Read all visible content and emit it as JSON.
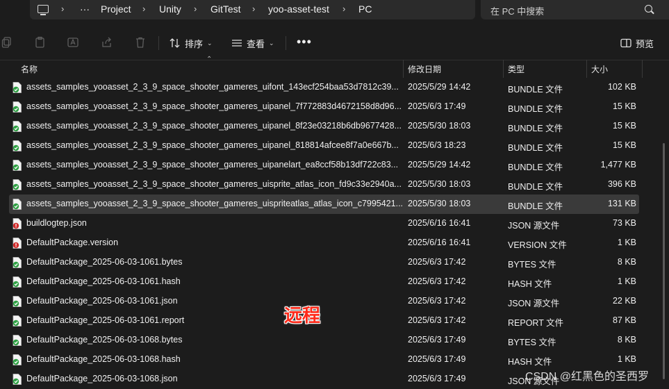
{
  "address_bar": {
    "breadcrumbs": [
      "Project",
      "Unity",
      "GitTest",
      "yoo-asset-test",
      "PC"
    ],
    "overflow": "···"
  },
  "search": {
    "placeholder": "在 PC 中搜索"
  },
  "toolbar": {
    "sort_label": "排序",
    "view_label": "查看",
    "preview_label": "预览"
  },
  "columns": {
    "name": "名称",
    "modified": "修改日期",
    "type": "类型",
    "size": "大小"
  },
  "files": [
    {
      "name": "assets_samples_yooasset_2_3_9_space_shooter_gameres_uifont_143ecf254baa53d7812c39...",
      "date": "2025/5/29 14:42",
      "type": "BUNDLE 文件",
      "size": "102 KB",
      "icon": "green-file-icon"
    },
    {
      "name": "assets_samples_yooasset_2_3_9_space_shooter_gameres_uipanel_7f772883d4672158d8d96...",
      "date": "2025/6/3 17:49",
      "type": "BUNDLE 文件",
      "size": "15 KB",
      "icon": "green-file-icon"
    },
    {
      "name": "assets_samples_yooasset_2_3_9_space_shooter_gameres_uipanel_8f23e03218b6db9677428...",
      "date": "2025/5/30 18:03",
      "type": "BUNDLE 文件",
      "size": "15 KB",
      "icon": "green-file-icon"
    },
    {
      "name": "assets_samples_yooasset_2_3_9_space_shooter_gameres_uipanel_818814afcee8f7a0e667b...",
      "date": "2025/6/3 18:23",
      "type": "BUNDLE 文件",
      "size": "15 KB",
      "icon": "green-file-icon"
    },
    {
      "name": "assets_samples_yooasset_2_3_9_space_shooter_gameres_uipanelart_ea8ccf58b13df722c83...",
      "date": "2025/5/29 14:42",
      "type": "BUNDLE 文件",
      "size": "1,477 KB",
      "icon": "green-file-icon"
    },
    {
      "name": "assets_samples_yooasset_2_3_9_space_shooter_gameres_uisprite_atlas_icon_fd9c33e2940a...",
      "date": "2025/5/30 18:03",
      "type": "BUNDLE 文件",
      "size": "396 KB",
      "icon": "green-file-icon"
    },
    {
      "name": "assets_samples_yooasset_2_3_9_space_shooter_gameres_uispriteatlas_atlas_icon_c7995421...",
      "date": "2025/5/30 18:03",
      "type": "BUNDLE 文件",
      "size": "131 KB",
      "icon": "green-file-icon",
      "selected": true
    },
    {
      "name": "buildlogtep.json",
      "date": "2025/6/16 16:41",
      "type": "JSON 源文件",
      "size": "73 KB",
      "icon": "red-file-icon"
    },
    {
      "name": "DefaultPackage.version",
      "date": "2025/6/16 16:41",
      "type": "VERSION 文件",
      "size": "1 KB",
      "icon": "red-file-icon"
    },
    {
      "name": "DefaultPackage_2025-06-03-1061.bytes",
      "date": "2025/6/3 17:42",
      "type": "BYTES 文件",
      "size": "8 KB",
      "icon": "green-file-icon"
    },
    {
      "name": "DefaultPackage_2025-06-03-1061.hash",
      "date": "2025/6/3 17:42",
      "type": "HASH 文件",
      "size": "1 KB",
      "icon": "green-file-icon"
    },
    {
      "name": "DefaultPackage_2025-06-03-1061.json",
      "date": "2025/6/3 17:42",
      "type": "JSON 源文件",
      "size": "22 KB",
      "icon": "green-file-icon"
    },
    {
      "name": "DefaultPackage_2025-06-03-1061.report",
      "date": "2025/6/3 17:42",
      "type": "REPORT 文件",
      "size": "87 KB",
      "icon": "green-file-icon"
    },
    {
      "name": "DefaultPackage_2025-06-03-1068.bytes",
      "date": "2025/6/3 17:49",
      "type": "BYTES 文件",
      "size": "8 KB",
      "icon": "green-file-icon"
    },
    {
      "name": "DefaultPackage_2025-06-03-1068.hash",
      "date": "2025/6/3 17:49",
      "type": "HASH 文件",
      "size": "1 KB",
      "icon": "green-file-icon"
    },
    {
      "name": "DefaultPackage_2025-06-03-1068.json",
      "date": "2025/6/3 17:49",
      "type": "JSON 源文件",
      "size": "",
      "icon": "green-file-icon"
    }
  ],
  "overlay_label": "远程",
  "watermark": "CSDN @红黑色的圣西罗",
  "colors": {
    "selected_row": "#3a3a3a",
    "overlay_label": "#ff2a1a",
    "sync_green": "#2ea043",
    "sync_red": "#d12c2c"
  }
}
